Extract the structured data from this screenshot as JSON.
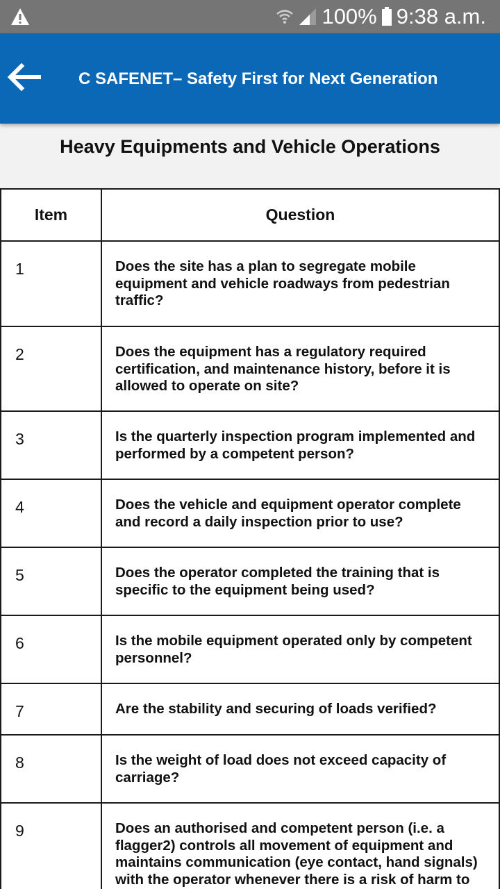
{
  "status_bar": {
    "battery": "100%",
    "time": "9:38 a.m."
  },
  "app_bar": {
    "title": "C SAFENET– Safety First for Next Generation"
  },
  "page": {
    "title": "Heavy Equipments and Vehicle Operations"
  },
  "table": {
    "headers": {
      "item": "Item",
      "question": "Question"
    },
    "rows": [
      {
        "item": "1",
        "question": "Does the site has a plan to segregate mobile equipment and vehicle roadways from pedestrian traffic?"
      },
      {
        "item": "2",
        "question": "Does the equipment has a regulatory required certification, and maintenance history, before it is allowed to operate on site?"
      },
      {
        "item": "3",
        "question": "Is the quarterly inspection program implemented and performed by a competent person?"
      },
      {
        "item": "4",
        "question": "Does the vehicle and equipment operator complete and record a daily inspection prior to use?"
      },
      {
        "item": "5",
        "question": "Does the operator completed the training that is specific to the equipment being used?"
      },
      {
        "item": "6",
        "question": "Is the mobile equipment operated only by competent personnel?"
      },
      {
        "item": "7",
        "question": "Are the stability and securing of loads verified?"
      },
      {
        "item": "8",
        "question": "Is the weight of load does not exceed capacity of carriage?"
      },
      {
        "item": "9",
        "question": "Does an authorised and competent person (i.e. a flagger2) controls all movement of equipment and maintains communication (eye contact, hand signals) with the operator whenever there is a risk of harm to"
      }
    ]
  },
  "colors": {
    "status_bar": "#757575",
    "app_bar": "#0b68b7",
    "page_header_bg": "#f2f2f2"
  },
  "icons": {
    "status_left": "warning-icon",
    "wifi": "wifi-icon",
    "signal": "signal-icon",
    "battery": "battery-icon",
    "back": "back-arrow-icon"
  }
}
